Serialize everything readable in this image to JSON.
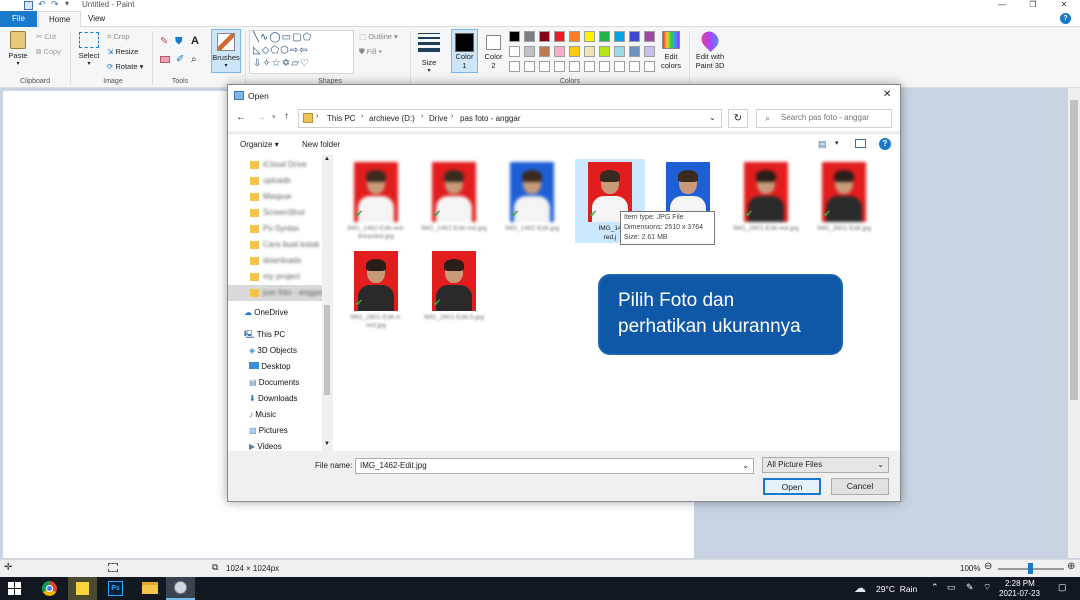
{
  "window": {
    "title": "Untitled - Paint"
  },
  "tabs": {
    "file": "File",
    "home": "Home",
    "view": "View"
  },
  "ribbon": {
    "paste": "Paste",
    "cut": "Cut",
    "copy": "Copy",
    "select": "Select",
    "crop": "Crop",
    "resize": "Resize",
    "rotate": "Rotate",
    "brushes": "Brushes",
    "outline": "Outline",
    "fill": "Fill",
    "size": "Size",
    "color1": "Color\n1",
    "color1_a": "Color",
    "color1_b": "1",
    "color2_a": "Color",
    "color2_b": "2",
    "edit_colors_a": "Edit",
    "edit_colors_b": "colors",
    "paint3d_a": "Edit with",
    "paint3d_b": "Paint 3D",
    "groups": {
      "clipboard": "Clipboard",
      "image": "Image",
      "tools": "Tools",
      "shapes": "Shapes",
      "colors": "Colors"
    },
    "palette_row1": [
      "#000000",
      "#7f7f7f",
      "#880015",
      "#ed1c24",
      "#ff7f27",
      "#fff200",
      "#22b14c",
      "#00a2e8",
      "#3f48cc",
      "#a349a4"
    ],
    "palette_row2": [
      "#ffffff",
      "#c3c3c3",
      "#b97a57",
      "#ffaec9",
      "#ffc90e",
      "#efe4b0",
      "#b5e61d",
      "#99d9ea",
      "#7092be",
      "#c8bfe7"
    ]
  },
  "dialog": {
    "title": "Open",
    "breadcrumb": [
      "This PC",
      "archieve (D:)",
      "Drive",
      "pas foto - anggar"
    ],
    "search_placeholder": "Search pas foto - anggar",
    "organize": "Organize",
    "new_folder": "New folder",
    "nav_blurred": [
      "iCloud Drive",
      "uploads",
      "Maspue",
      "ScreenShot",
      "Ps-Syntax",
      "Cara buat kotak",
      "downloads",
      "my project",
      "pas foto - anggar"
    ],
    "nav": {
      "onedrive": "OneDrive",
      "thispc": "This PC",
      "objects3d": "3D Objects",
      "desktop": "Desktop",
      "documents": "Documents",
      "downloads": "Downloads",
      "music": "Music",
      "pictures": "Pictures",
      "videos": "Videos"
    },
    "files_row1": [
      {
        "name": "IMG_1462-Edit-red-breasted.jpg",
        "bg": "#e21d1d",
        "shirt": "#f4f4f4",
        "blur": true
      },
      {
        "name": "IMG_1462-Edit-red.jpg",
        "bg": "#e21d1d",
        "shirt": "#f4f4f4",
        "blur": true
      },
      {
        "name": "IMG_1462-Edit.jpg",
        "bg": "#1f5fd6",
        "shirt": "#f4f4f4",
        "blur": true
      },
      {
        "name": "IMG_14",
        "name2": "red.j",
        "bg": "#e21d1d",
        "shirt": "#f4f4f4",
        "blur": false
      },
      {
        "name": "it.jp",
        "bg": "#1f5fd6",
        "shirt": "#f4f4f4",
        "blur": false
      },
      {
        "name": "IMG_2801-Edit-red.jpg",
        "bg": "#e21d1d",
        "shirt": "#2a2a2a",
        "blur": true
      },
      {
        "name": "IMG_2801-Edit.jpg",
        "bg": "#e21d1d",
        "shirt": "#2a2a2a",
        "blur": true
      }
    ],
    "files_row2": [
      {
        "name": "IMG_2801-Edit-4-red.jpg",
        "bg": "#e21d1d",
        "shirt": "#2a2a2a"
      },
      {
        "name": "IMG_2801-Edit-5.jpg",
        "bg": "#e21d1d",
        "shirt": "#2a2a2a"
      }
    ],
    "tooltip": {
      "type": "Item type: JPG File",
      "dimensions": "Dimensions: 2510 x 3764",
      "size": "Size: 2.61 MB"
    },
    "filename_label": "File name:",
    "filename_value": "IMG_1462-Edit.jpg",
    "filetype": "All Picture Files",
    "open_button": "Open",
    "cancel_button": "Cancel"
  },
  "callout": {
    "line1": "Pilih Foto dan",
    "line2": "perhatikan ukurannya"
  },
  "status": {
    "canvas_size": "1024 × 1024px",
    "zoom": "100%"
  },
  "taskbar": {
    "weather": "29°C  Rain",
    "time": "2:28 PM",
    "date": "2021-07-23"
  }
}
